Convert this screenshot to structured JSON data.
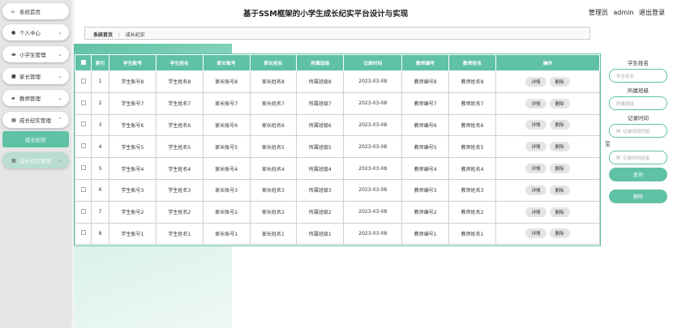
{
  "header": {
    "title": "基于SSM框架的小学生成长纪实平台设计与实现",
    "role": "管理员",
    "username": "admin",
    "logout": "退出登录"
  },
  "sidebar": {
    "items": [
      {
        "label": "系统首页",
        "icon": "home-icon"
      },
      {
        "label": "个人中心",
        "icon": "user-icon"
      },
      {
        "label": "小学生管理",
        "icon": "student-icon"
      },
      {
        "label": "家长管理",
        "icon": "parent-icon"
      },
      {
        "label": "教师管理",
        "icon": "teacher-icon"
      },
      {
        "label": "成长纪实管理",
        "icon": "grid-icon"
      },
      {
        "label": "成长纪实"
      },
      {
        "label": "成长纪实管理",
        "icon": "grid-icon"
      }
    ]
  },
  "breadcrumb": {
    "home": "系统首页",
    "sep": "⋮",
    "current": "成长纪实"
  },
  "table": {
    "headers": [
      "索引",
      "学生账号",
      "学生姓名",
      "家长账号",
      "家长姓名",
      "所属班级",
      "记录时间",
      "教师编号",
      "教师姓名",
      "操作"
    ],
    "detail_label": "详情",
    "delete_label": "删除",
    "rows": [
      [
        "1",
        "学生账号8",
        "学生姓名8",
        "家长账号8",
        "家长姓名8",
        "所属班级8",
        "2023-03-08",
        "教师编号8",
        "教师姓名8"
      ],
      [
        "2",
        "学生账号7",
        "学生姓名7",
        "家长账号7",
        "家长姓名7",
        "所属班级7",
        "2023-03-08",
        "教师编号7",
        "教师姓名7"
      ],
      [
        "3",
        "学生账号6",
        "学生姓名6",
        "家长账号6",
        "家长姓名6",
        "所属班级6",
        "2023-03-08",
        "教师编号6",
        "教师姓名6"
      ],
      [
        "4",
        "学生账号5",
        "学生姓名5",
        "家长账号5",
        "家长姓名5",
        "所属班级5",
        "2023-03-08",
        "教师编号5",
        "教师姓名5"
      ],
      [
        "5",
        "学生账号4",
        "学生姓名4",
        "家长账号4",
        "家长姓名4",
        "所属班级4",
        "2023-03-08",
        "教师编号4",
        "教师姓名4"
      ],
      [
        "6",
        "学生账号3",
        "学生姓名3",
        "家长账号3",
        "家长姓名3",
        "所属班级3",
        "2023-03-08",
        "教师编号3",
        "教师姓名3"
      ],
      [
        "7",
        "学生账号2",
        "学生姓名2",
        "家长账号2",
        "家长姓名2",
        "所属班级2",
        "2023-03-08",
        "教师编号2",
        "教师姓名2"
      ],
      [
        "8",
        "学生账号1",
        "学生姓名1",
        "家长账号1",
        "家长姓名1",
        "所属班级1",
        "2023-03-08",
        "教师编号1",
        "教师姓名1"
      ]
    ]
  },
  "search": {
    "student_name_label": "学生姓名",
    "student_name_placeholder": "学生姓名",
    "class_label": "所属班级",
    "class_placeholder": "所属班级",
    "time_label": "记录时间",
    "start_placeholder": "记录时间开始",
    "to": "至",
    "end_placeholder": "记录时间结束",
    "search_button": "查询",
    "delete_button": "删除"
  },
  "colors": {
    "accent": "#5fc1a5"
  }
}
